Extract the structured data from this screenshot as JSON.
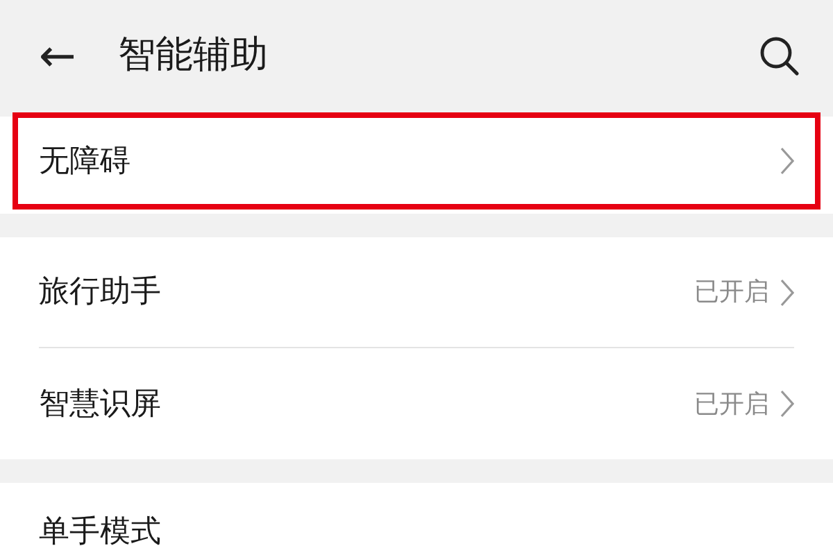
{
  "header": {
    "back_icon": "←",
    "title": "智能辅助"
  },
  "sections": [
    {
      "items": [
        {
          "label": "无障碍",
          "highlighted": true
        }
      ]
    },
    {
      "items": [
        {
          "label": "旅行助手",
          "status": "已开启",
          "highlighted": false
        },
        {
          "label": "智慧识屏",
          "status": "已开启",
          "highlighted": false
        }
      ]
    },
    {
      "items": [
        {
          "label": "单手模式",
          "highlighted": false,
          "chevron": false
        }
      ]
    }
  ]
}
